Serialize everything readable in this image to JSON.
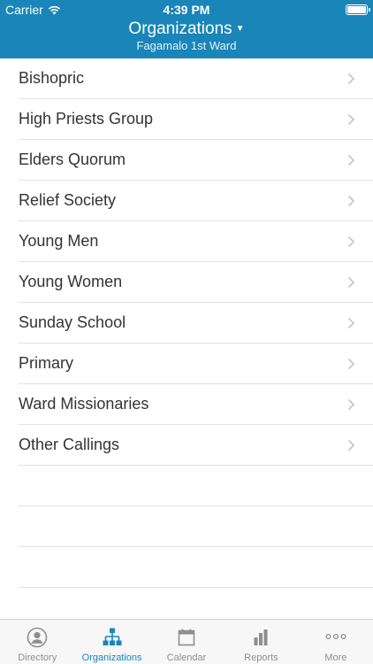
{
  "status_bar": {
    "carrier": "Carrier",
    "time": "4:39 PM"
  },
  "nav": {
    "title": "Organizations",
    "subtitle": "Fagamalo 1st Ward"
  },
  "list": {
    "items": [
      {
        "label": "Bishopric"
      },
      {
        "label": "High Priests Group"
      },
      {
        "label": "Elders Quorum"
      },
      {
        "label": "Relief Society"
      },
      {
        "label": "Young Men"
      },
      {
        "label": "Young Women"
      },
      {
        "label": "Sunday School"
      },
      {
        "label": "Primary"
      },
      {
        "label": "Ward Missionaries"
      },
      {
        "label": "Other Callings"
      }
    ]
  },
  "tabbar": {
    "tabs": [
      {
        "label": "Directory",
        "icon": "person-icon"
      },
      {
        "label": "Organizations",
        "icon": "org-chart-icon",
        "active": true
      },
      {
        "label": "Calendar",
        "icon": "calendar-icon"
      },
      {
        "label": "Reports",
        "icon": "bar-chart-icon"
      },
      {
        "label": "More",
        "icon": "more-icon"
      }
    ]
  },
  "colors": {
    "accent": "#1a85b8",
    "tab_inactive": "#8e8e8e",
    "text": "#333333"
  }
}
